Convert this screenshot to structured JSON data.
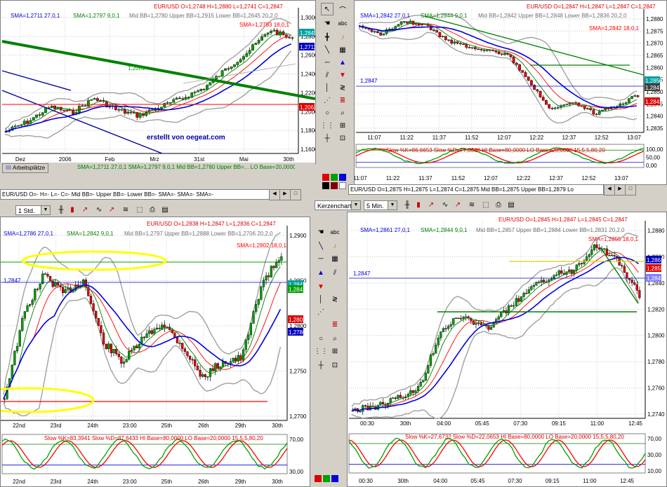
{
  "tl": {
    "ohlc": "EUR/USD O=1,2748 H=1,2880 L=1,2741 C=1,2847",
    "sma_blue": "SMA=1,2711 27,0,1",
    "sma_green": "SMA=1,2797 9,0,1",
    "bb": "Mid BB=1,2780 Upper BB=1,2915 Lower BB=1,2645 20,2,0",
    "sma_red": "SMA=1,2793 18,0,1",
    "yaxis": [
      "1,3000",
      "1,2800",
      "1,2600",
      "1,2400",
      "1,2200",
      "1,2000",
      "1,1800",
      "1,1600"
    ],
    "xaxis": [
      "Dez",
      "2006",
      "Feb",
      "Mrz",
      "31st",
      "Mai",
      "30th"
    ],
    "price_tags": [
      "1,2847",
      "1,2711",
      "1,2061"
    ],
    "hline_label": "1,2061",
    "mid_label": "1,2061",
    "watermark": "erstellt von oegeat.com",
    "workspace_label": "Arbeitsplätze",
    "footer_text": "SMA=1,2711 27,0,1   SMA=1,2797 9,0,1   Mid BB=1,2780 Upper BB=... LO Base=20,0000   15,5,5,80,20",
    "status": "EUR/USD O=- H=- L=- C=-  Mid BB=- Upper BB=- Lower BB=- SMA=- SMA=- SMA=-"
  },
  "tr": {
    "ohlc": "EUR/USD O=1,2847 H=1,2847 L=1,2847 C=1,2847",
    "sma_blue": "SMA=1,2842 27,0,1",
    "sma_green": "SMA=1,2844 9,0,1",
    "bb": "Mid BB=1,2842 Upper BB=1,2848 Lower BB=1,2836 20,2,0",
    "sma_red": "SMA=1,2842 18,0,1",
    "yaxis": [
      "1,2880",
      "1,2875",
      "1,2870",
      "1,2865",
      "1,2860",
      "1,2855",
      "1,2850",
      "1,2845",
      "1,2840",
      "1,2835"
    ],
    "xaxis": [
      "11:07",
      "11:22",
      "11:37",
      "11:52",
      "12:07",
      "12:22",
      "12:37",
      "12:52",
      "13:07"
    ],
    "price_tags": [
      "1,2850",
      "1,2847",
      "1,2842"
    ],
    "hline_label": "1,2847",
    "stoch": "Slow %K=86,6653  Slow %D=77,0648  HI Base=80,0000  LO Base=20,0000   15,5,5,80,20",
    "stoch_axis": [
      "100,00",
      "50,00",
      "0,00"
    ],
    "status": "EUR/USD O=1,2875 H=1,2875 L=1,2874 C=1,2875  Mid BB=1,2875 Upper BB=1,2879 Lo"
  },
  "bl": {
    "ohlc": "EUR/USD O=1,2838 H=1,2847 L=1,2836 C=1,2847",
    "sma_blue": "SMA=1,2786 27,0,1",
    "sma_green": "SMA=1,2842 9,0,1",
    "bb": "Mid BB=1,2797 Upper BB=1,2888 Lower BB=1,2706 20,2,0",
    "sma_red": "SMA=1,2802 18,0,1",
    "yaxis": [
      "1,2900",
      "1,2850",
      "1,2800",
      "1,2750",
      "1,2700"
    ],
    "xaxis": [
      "22nd",
      "23rd",
      "24th",
      "23:00",
      "25th",
      "26th",
      "29th",
      "30th"
    ],
    "price_tags": [
      "1,2847",
      "1,2842",
      "1,2802",
      "1,2786"
    ],
    "hline_label": "1,2847",
    "period": "1 Std.",
    "stoch": "Slow %K=83,3941  Slow %D=87,6433  HI Base=80,0000  LO Base=20,0000   15,5,5,80,20",
    "stoch_axis": [
      "70,00",
      "30,00"
    ]
  },
  "br": {
    "ohlc": "EUR/USD O=1,2845 H=1,2847 L=1,2845 C=1,2847",
    "sma_blue": "SMA=1,2861 27,0,1",
    "sma_green": "SMA=1,2844 9,0,1",
    "bb": "Mid BB=1,2857 Upper BB=1,2884 Lower BB=1,2831 20,2,0",
    "sma_red": "SMA=1,2855 18,0,1",
    "yaxis": [
      "1,2880",
      "1,2860",
      "1,2840",
      "1,2820",
      "1,2800",
      "1,2780",
      "1,2760",
      "1,2740"
    ],
    "xaxis": [
      "00:30",
      "30th",
      "04:00",
      "05:45",
      "07:30",
      "09:15",
      "11:00",
      "12:45"
    ],
    "price_tags": [
      "1,2861",
      "1,2855",
      "1,2847"
    ],
    "hline_label": "1,2847",
    "chart_type": "Kerzenchart",
    "period": "5 Min.",
    "stoch": "Slow %K=27,6732  Slow %D=22,0653  HI Base=80,0000  LO Base=20,0000   15,5,5,80,20",
    "stoch_axis": [
      "70,00",
      "30,00",
      "10,00"
    ]
  },
  "colors": {
    "up": "#00a000",
    "down": "#e00000",
    "blue": "#0000e0",
    "green": "#008000",
    "red": "#ff0000",
    "bb": "#a0a0a0",
    "yellow": "#ffff00",
    "navy": "#0000a0"
  }
}
